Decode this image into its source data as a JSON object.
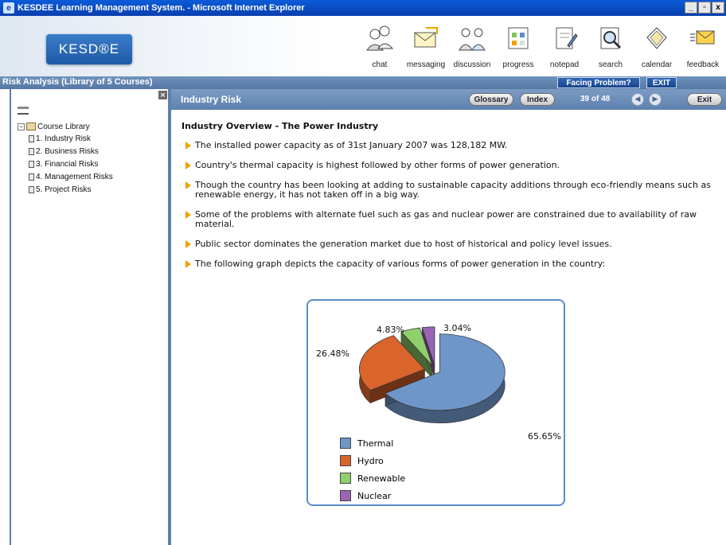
{
  "window": {
    "title": "KESDEE Learning Management System. - Microsoft Internet Explorer"
  },
  "header": {
    "logo_text": "KESD®E",
    "tools": [
      {
        "label": "chat",
        "icon": "chat-icon"
      },
      {
        "label": "messaging",
        "icon": "messaging-icon"
      },
      {
        "label": "discussion",
        "icon": "discussion-icon"
      },
      {
        "label": "progress",
        "icon": "progress-icon"
      },
      {
        "label": "notepad",
        "icon": "notepad-icon"
      },
      {
        "label": "search",
        "icon": "search-icon"
      },
      {
        "label": "calendar",
        "icon": "calendar-icon"
      },
      {
        "label": "feedback",
        "icon": "feedback-icon"
      }
    ]
  },
  "coursebar": {
    "title": "Risk Analysis (Library of 5 Courses)",
    "facing_problem": "Facing Problem?",
    "exit": "EXIT"
  },
  "sidebar": {
    "root_label": "Course Library",
    "items": [
      {
        "label": "1. Industry Risk"
      },
      {
        "label": "2. Business Risks"
      },
      {
        "label": "3. Financial Risks"
      },
      {
        "label": "4. Management Risks"
      },
      {
        "label": "5. Project Risks"
      }
    ]
  },
  "contentbar": {
    "title": "Industry Risk",
    "glossary": "Glossary",
    "index": "Index",
    "page_count": "39 of 48",
    "exit": "Exit"
  },
  "content": {
    "heading": "Industry Overview - The Power Industry",
    "bullets": [
      "The installed power capacity as of 31st January 2007 was 128,182 MW.",
      "Country's thermal capacity is highest followed by other forms of power generation.",
      "Though the country has been looking at adding to sustainable capacity additions through eco-friendly means such as renewable energy, it has not taken off in a big way.",
      "Some of the problems with alternate fuel such as gas and nuclear power are constrained due to availability of raw material.",
      "Public sector dominates the generation market due to host of historical and policy level issues.",
      "The following graph depicts the capacity of various forms of power generation in the country:"
    ]
  },
  "chart_data": {
    "type": "pie",
    "categories": [
      "Thermal",
      "Hydro",
      "Renewable",
      "Nuclear"
    ],
    "values": [
      65.65,
      26.48,
      4.83,
      3.04
    ],
    "labels": [
      "65.65%",
      "26.48%",
      "4.83%",
      "3.04%"
    ],
    "colors": [
      "#6f96c8",
      "#d9642c",
      "#8fd06c",
      "#9a64b4"
    ],
    "legend": "bottom-left"
  }
}
